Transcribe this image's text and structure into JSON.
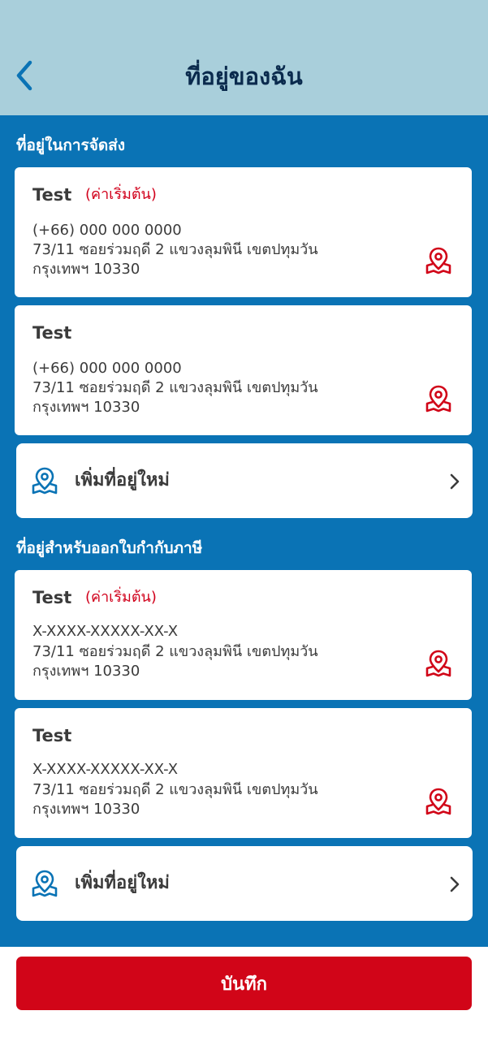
{
  "header": {
    "title": "ที่อยู่ของฉัน",
    "back_icon": "chevron-left-icon"
  },
  "colors": {
    "header_bg": "#a9cfdb",
    "main_bg": "#0a73b5",
    "accent_red": "#d10518",
    "title_navy": "#0a2a4d",
    "icon_blue": "#0a73b5"
  },
  "shipping": {
    "section_title": "ที่อยู่ในการจัดส่ง",
    "cards": [
      {
        "name": "Test",
        "default_label": "(ค่าเริ่มต้น)",
        "line1": "(+66) 000 000 0000",
        "line2": "73/11 ซอยร่วมฤดี 2 แขวงลุมพินี เขตปทุมวัน",
        "line3": "กรุงเทพฯ 10330",
        "icon": "map-pin-icon"
      },
      {
        "name": "Test",
        "default_label": "",
        "line1": "(+66) 000 000 0000",
        "line2": "73/11 ซอยร่วมฤดี 2 แขวงลุมพินี เขตปทุมวัน",
        "line3": "กรุงเทพฯ 10330",
        "icon": "map-pin-icon"
      }
    ],
    "add_label": "เพิ่มที่อยู่ใหม่"
  },
  "tax": {
    "section_title": "ที่อยู่สำหรับออกใบกำกับภาษี",
    "cards": [
      {
        "name": "Test",
        "default_label": "(ค่าเริ่มต้น)",
        "line1": "X-XXXX-XXXXX-XX-X",
        "line2": "73/11 ซอยร่วมฤดี 2 แขวงลุมพินี เขตปทุมวัน",
        "line3": "กรุงเทพฯ 10330",
        "icon": "map-pin-icon"
      },
      {
        "name": "Test",
        "default_label": "",
        "line1": "X-XXXX-XXXXX-XX-X",
        "line2": "73/11 ซอยร่วมฤดี 2 แขวงลุมพินี เขตปทุมวัน",
        "line3": "กรุงเทพฯ 10330",
        "icon": "map-pin-icon"
      }
    ],
    "add_label": "เพิ่มที่อยู่ใหม่"
  },
  "footer": {
    "save_label": "บันทึก"
  }
}
